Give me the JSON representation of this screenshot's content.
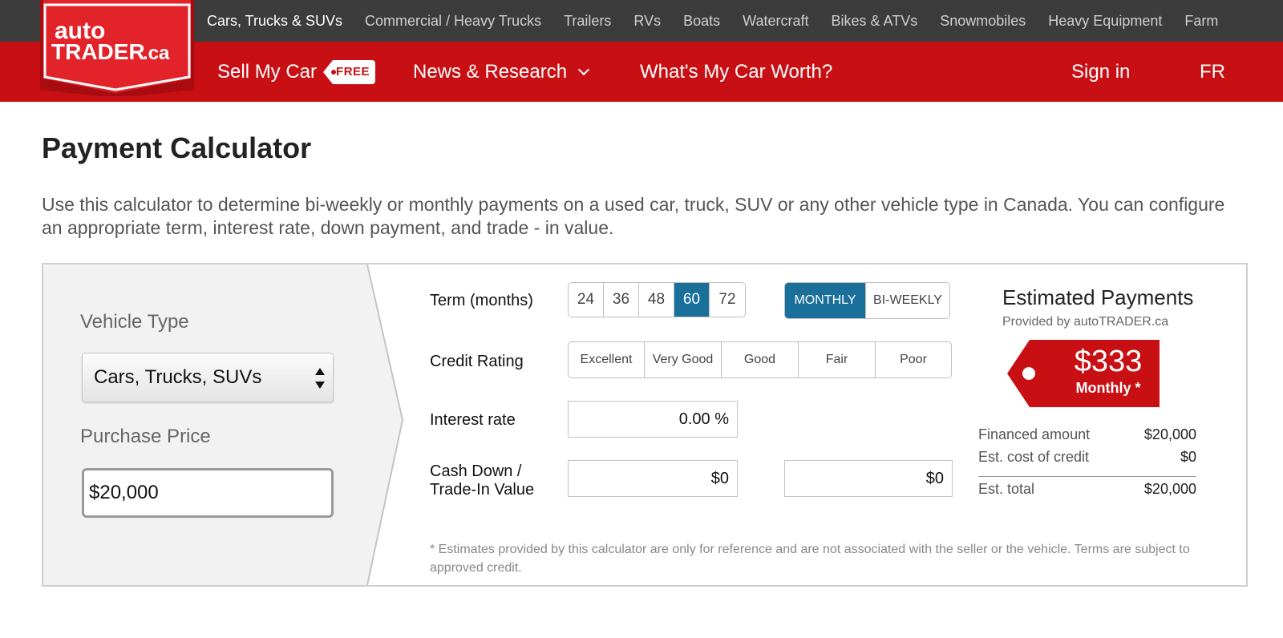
{
  "categories": [
    {
      "label": "Cars, Trucks & SUVs",
      "active": true
    },
    {
      "label": "Commercial / Heavy Trucks",
      "active": false
    },
    {
      "label": "Trailers",
      "active": false
    },
    {
      "label": "RVs",
      "active": false
    },
    {
      "label": "Boats",
      "active": false
    },
    {
      "label": "Watercraft",
      "active": false
    },
    {
      "label": "Bikes & ATVs",
      "active": false
    },
    {
      "label": "Snowmobiles",
      "active": false
    },
    {
      "label": "Heavy Equipment",
      "active": false
    },
    {
      "label": "Farm",
      "active": false
    }
  ],
  "logo": {
    "line1": "auto",
    "line2": "TRADER",
    "suffix": ".ca"
  },
  "nav": {
    "sell": "Sell My Car",
    "free": "FREE",
    "news": "News & Research",
    "worth": "What's My Car Worth?",
    "signin": "Sign in",
    "lang": "FR"
  },
  "page": {
    "title": "Payment Calculator",
    "intro": "Use this calculator to determine bi-weekly or monthly payments on a used car, truck, SUV or any other vehicle type in Canada. You can configure an appropriate term, interest rate, down payment, and trade - in value."
  },
  "calc": {
    "vehicle_type_label": "Vehicle Type",
    "vehicle_type_value": "Cars, Trucks, SUVs",
    "purchase_price_label": "Purchase Price",
    "purchase_price_value": "$20,000",
    "term_label": "Term (months)",
    "terms": [
      "24",
      "36",
      "48",
      "60",
      "72"
    ],
    "selected_term": "60",
    "frequency": [
      "MONTHLY",
      "BI-WEEKLY"
    ],
    "selected_frequency": "MONTHLY",
    "credit_label": "Credit Rating",
    "credit": [
      "Excellent",
      "Very Good",
      "Good",
      "Fair",
      "Poor"
    ],
    "interest_label": "Interest rate",
    "interest_value": "0.00 %",
    "cash_label_1": "Cash Down /",
    "cash_label_2": "Trade-In Value",
    "cash_down_value": "$0",
    "trade_in_value": "$0",
    "footnote": "* Estimates provided by this calculator are only for reference and are not associated with the seller or the vehicle. Terms are subject to approved credit."
  },
  "estimate": {
    "title": "Estimated Payments",
    "subtitle": "Provided by autoTRADER.ca",
    "amount": "$333",
    "period": "Monthly",
    "asterisk": "*",
    "financed_label": "Financed amount",
    "financed_value": "$20,000",
    "cost_label": "Est. cost of credit",
    "cost_value": "$0",
    "total_label": "Est. total",
    "total_value": "$20,000"
  },
  "colors": {
    "brand_red": "#c80f14",
    "top_bar": "#3c3c3c",
    "selected_blue": "#1a6f9b"
  }
}
